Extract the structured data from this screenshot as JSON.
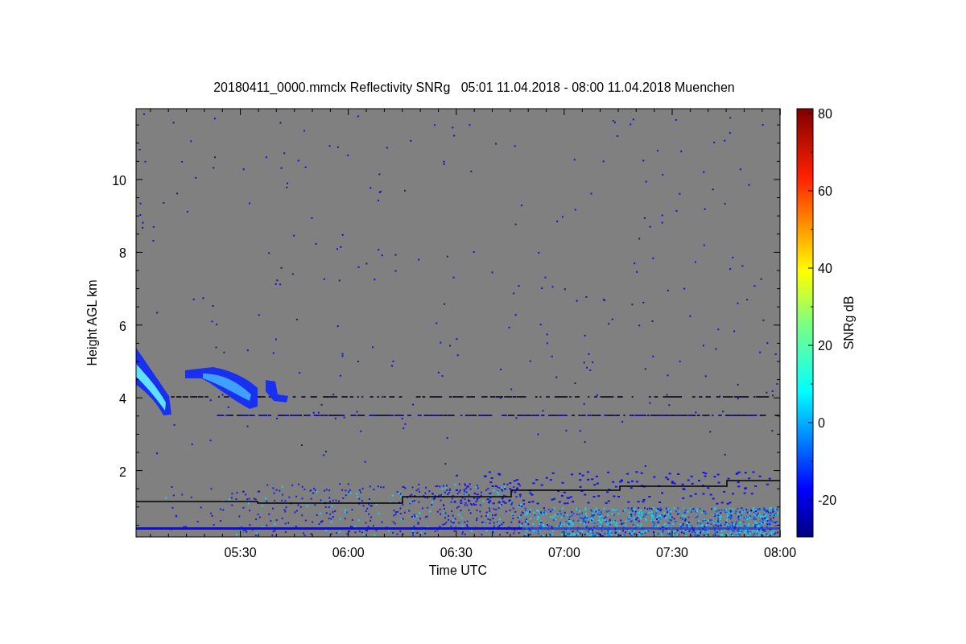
{
  "title": "20180411_0000.mmclx Reflectivity SNRg   05:01 11.04.2018 - 08:00 11.04.2018 Muenchen",
  "x_axis": {
    "label": "Time UTC",
    "ticks": [
      "05:30",
      "06:00",
      "06:30",
      "07:00",
      "07:30",
      "08:00"
    ]
  },
  "y_axis": {
    "label": "Height AGL km",
    "ticks": [
      "10",
      "8",
      "6",
      "4",
      "2"
    ]
  },
  "colorbar": {
    "label": "SNRg dB",
    "ticks": [
      "80",
      "60",
      "40",
      "20",
      "0",
      "-20"
    ]
  }
}
